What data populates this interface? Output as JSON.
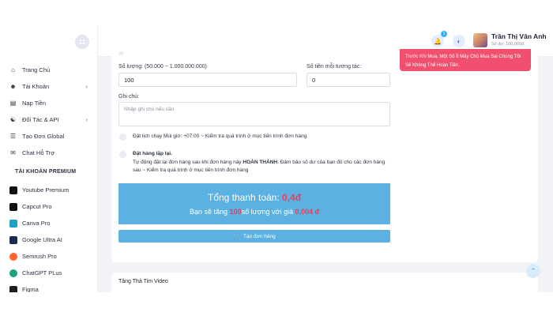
{
  "header": {
    "user_name": "Trần Thị Vân Anh",
    "balance": "Số dư: 100,000đ",
    "notif_count": "1"
  },
  "sidebar": {
    "items": [
      {
        "label": "Trang Chủ",
        "icon": "home-icon"
      },
      {
        "label": "Tài Khoản",
        "icon": "user-icon",
        "has_chevron": true
      },
      {
        "label": "Nạp Tiền",
        "icon": "wallet-icon"
      },
      {
        "label": "Đối Tác & API",
        "icon": "handshake-icon",
        "has_chevron": true
      },
      {
        "label": "Tạo Đơn Global",
        "icon": "cart-icon"
      },
      {
        "label": "Chat Hỗ Trợ",
        "icon": "chat-icon"
      }
    ],
    "section_title": "TÀI KHOẢN PREMIUM",
    "premium": [
      {
        "label": "Youtube Premium",
        "color": "#111111"
      },
      {
        "label": "Capcut Pro",
        "color": "#111111"
      },
      {
        "label": "Canva Pro",
        "color": "#1da1c9"
      },
      {
        "label": "Google Ultra AI",
        "color": "#1b2a52"
      },
      {
        "label": "Semrush Pro",
        "color": "#ff642d"
      },
      {
        "label": "ChatGPT PLus",
        "color": "#19a37f"
      },
      {
        "label": "Figma",
        "color": "#1e1e1e"
      }
    ]
  },
  "form": {
    "quantity_label": "Số lượng: (50.000 ~ 1.000.000.000)",
    "quantity_value": "100",
    "price_label": "Số tiền mỗi tương tác:",
    "price_value": "0",
    "note_label": "Ghi chú:",
    "note_placeholder": "Nhập ghi chú nếu cần",
    "schedule_text": "Đặt lịch chạy Múi giờ: +07:00 ~ Kiểm tra quá trình ở mục tiến trình đơn hàng",
    "repeat_title": "Đặt hàng lặp lại.",
    "repeat_desc_1": "Tự động đặt lại đơn hàng sau khi đơn hàng này ",
    "repeat_desc_bold": "HOÀN THÀNH",
    "repeat_desc_2": ". Đảm bảo số dư của bạn đủ cho các đơn hàng sau ~ Kiểm tra quá trình ở mục tiến trình đơn hàng"
  },
  "notice": {
    "text": "Trước Khi Mua, Một Số Ít Máy Chủ Mua Sai Chúng Tôi Sẽ Không Thể Hoàn Tiền."
  },
  "summary": {
    "total_prefix": "Tổng thanh toán: ",
    "total_value": "0,4đ",
    "sub_prefix": "Bạn sẽ tăng ",
    "sub_qty": "100",
    "sub_mid": "số lượng với giá ",
    "sub_price": "0,004 đ"
  },
  "order_button": "Tạo đơn hàng",
  "next_section_title": "Tăng Thả Tim Video",
  "colors": {
    "accent": "#5bb1e2",
    "danger": "#f04f6e",
    "highlight": "#e8405a"
  }
}
